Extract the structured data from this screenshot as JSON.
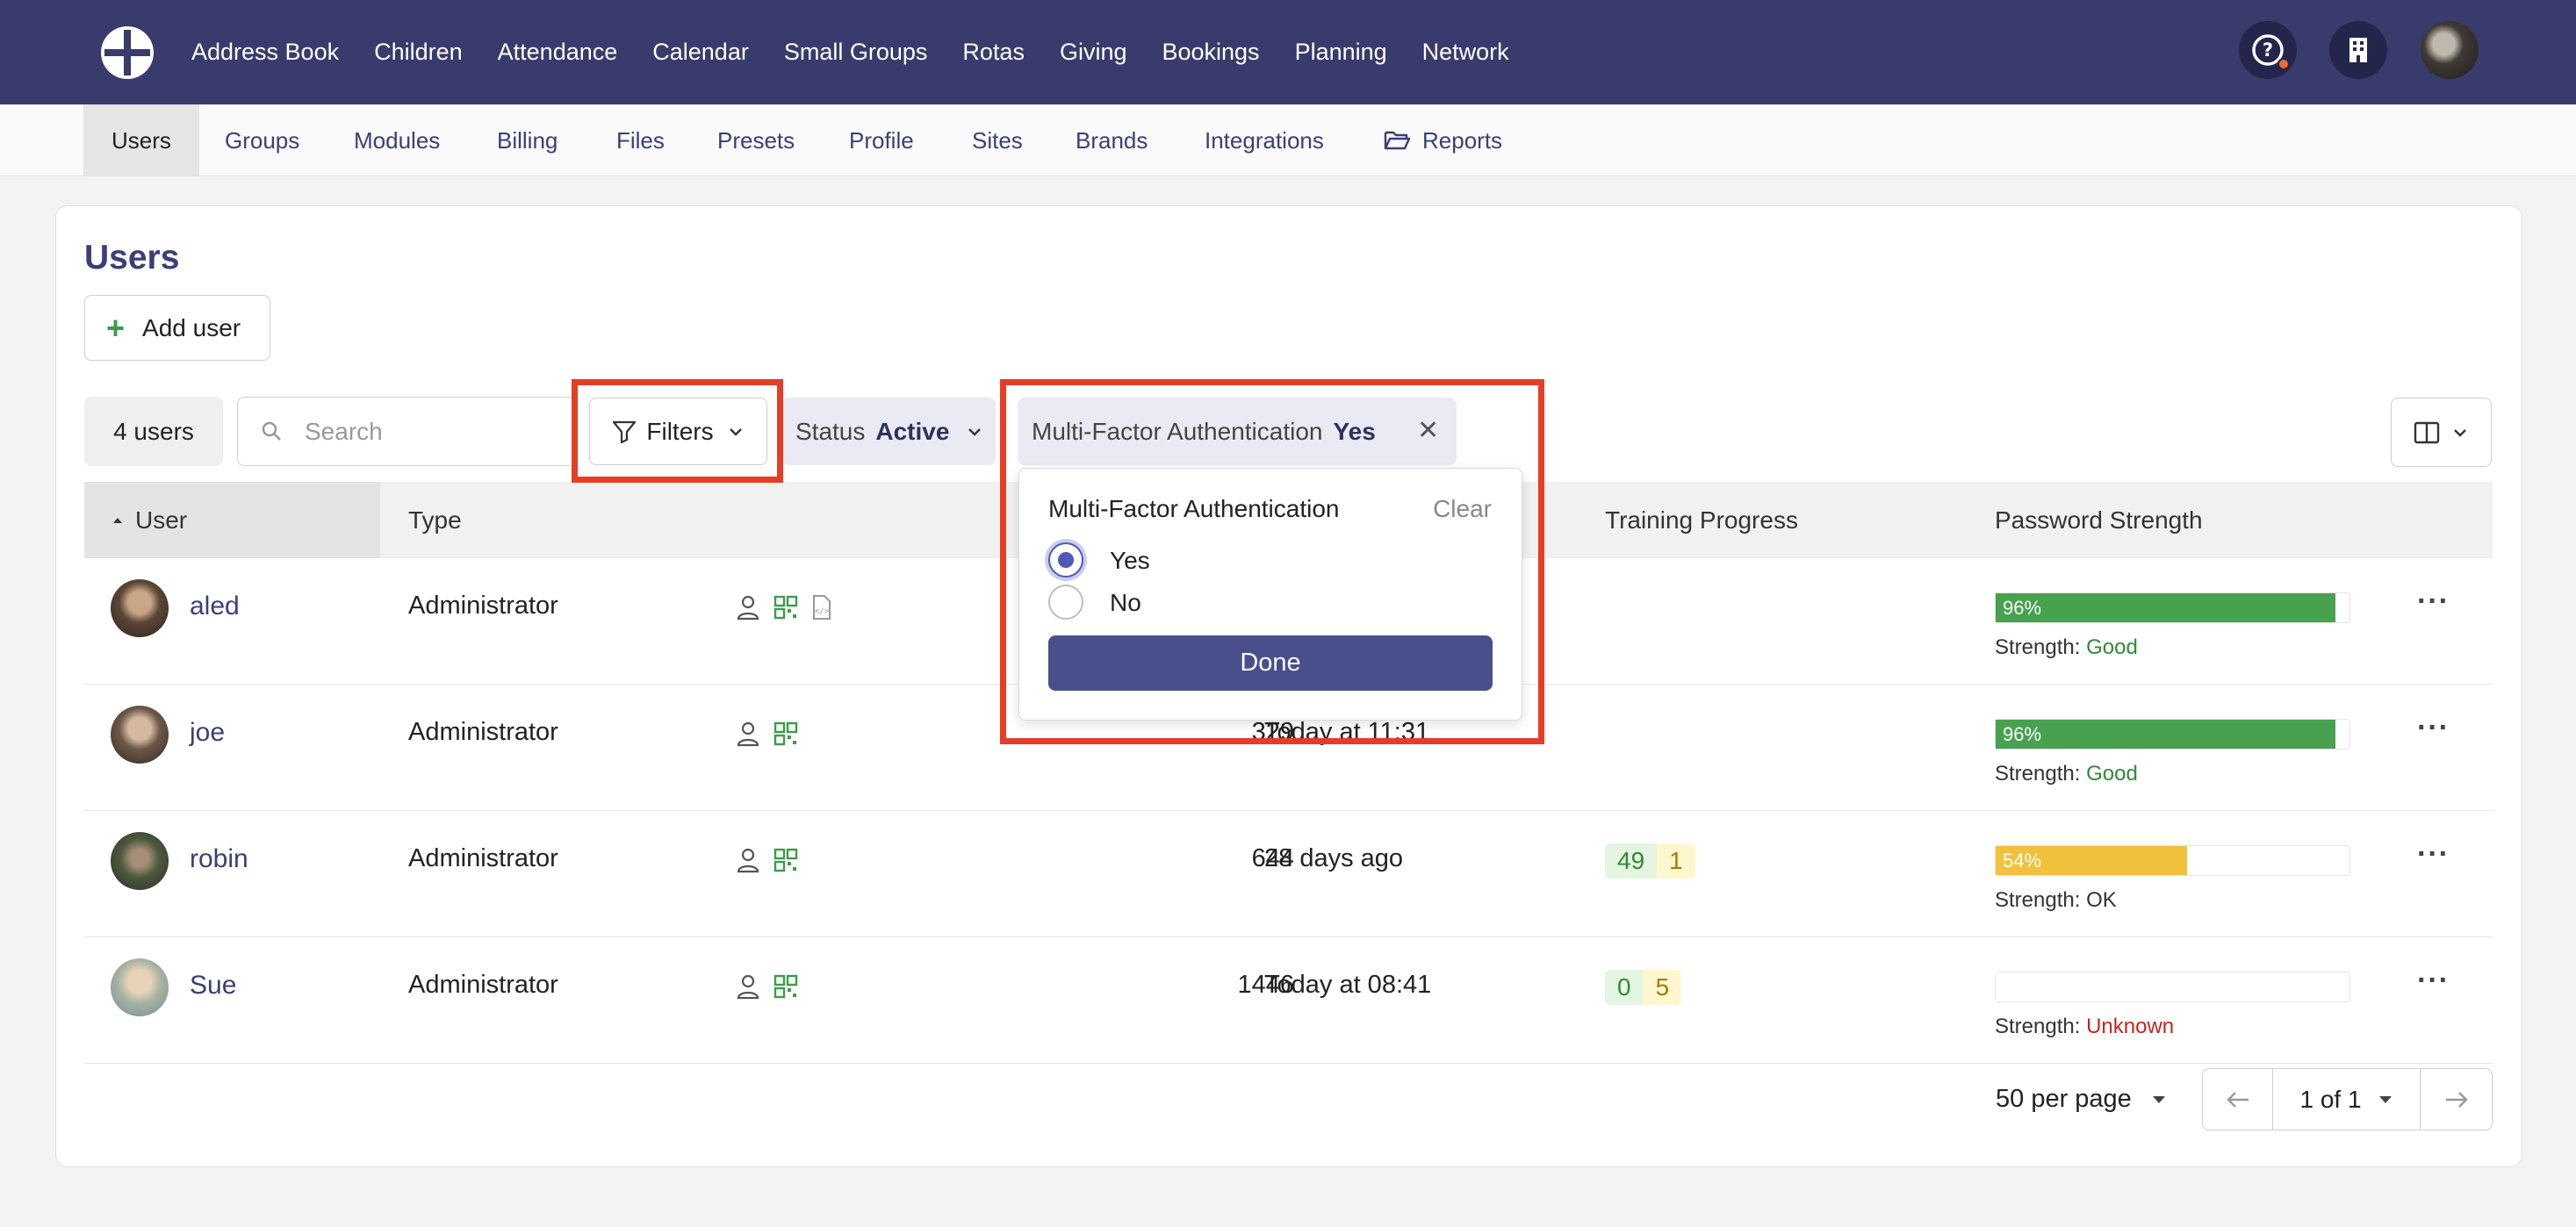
{
  "topnav": {
    "items": [
      "Address Book",
      "Children",
      "Attendance",
      "Calendar",
      "Small Groups",
      "Rotas",
      "Giving",
      "Bookings",
      "Planning",
      "Network"
    ]
  },
  "subnav": {
    "tabs": [
      "Users",
      "Groups",
      "Modules",
      "Billing",
      "Files",
      "Presets",
      "Profile",
      "Sites",
      "Brands",
      "Integrations",
      "Reports"
    ]
  },
  "page": {
    "title": "Users",
    "add_user_label": "Add user",
    "user_count": "4 users",
    "search_placeholder": "Search",
    "filters_label": "Filters",
    "status_chip": {
      "label": "Status",
      "value": "Active"
    },
    "mfa_chip": {
      "label": "Multi-Factor Authentication",
      "value": "Yes"
    }
  },
  "table": {
    "headers": {
      "user": "User",
      "type": "Type",
      "training": "Training Progress",
      "password": "Password Strength"
    },
    "rows": [
      {
        "name": "aled",
        "type": "Administrator",
        "strength_label": "Strength:",
        "strength": "Good",
        "strength_color": "#2f8a35",
        "pw_percent": "96%",
        "pw_color": "#47a14f",
        "pw_fraction": 0.96
      },
      {
        "name": "joe",
        "type": "Administrator",
        "count": "329",
        "last_seen": "Today at 11:31",
        "strength_label": "Strength:",
        "strength": "Good",
        "strength_color": "#2f8a35",
        "pw_percent": "96%",
        "pw_color": "#47a14f",
        "pw_fraction": 0.96
      },
      {
        "name": "robin",
        "type": "Administrator",
        "count": "644",
        "last_seen": "28 days ago",
        "train_done": "49",
        "train_todo": "1",
        "strength_label": "Strength:",
        "strength": "OK",
        "strength_color": "#333333",
        "pw_percent": "54%",
        "pw_color": "#f0c23c",
        "pw_fraction": 0.54
      },
      {
        "name": "Sue",
        "type": "Administrator",
        "count": "1446",
        "last_seen": "Today at 08:41",
        "train_done": "0",
        "train_todo": "5",
        "strength_label": "Strength:",
        "strength": "Unknown",
        "strength_color": "#c0281b",
        "pw_percent": "",
        "pw_color": "#ffffff",
        "pw_fraction": 0
      }
    ]
  },
  "dropdown": {
    "title": "Multi-Factor Authentication",
    "clear_label": "Clear",
    "options": [
      "Yes",
      "No"
    ],
    "selected": "Yes",
    "done_label": "Done"
  },
  "pagination": {
    "per_page": "50 per page",
    "page_label": "1 of 1"
  },
  "colors": {
    "nav_bg": "#383b6b",
    "accent": "#484f8a",
    "highlight": "#e53d26"
  }
}
